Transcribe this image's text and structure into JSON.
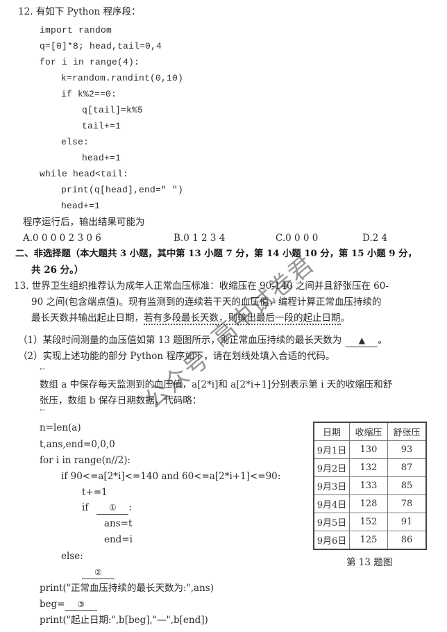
{
  "q12": {
    "title": "12. 有如下 Python 程序段：",
    "code": [
      "import random",
      "q=[0]*8; head,tail=0,4",
      "for i in range(4):",
      "k=random.randint(0,10)",
      "if k%2==0:",
      "q[tail]=k%5",
      "tail+=1",
      "else:",
      "head+=1",
      "while head<tail:",
      "print(q[head],end=\" \")",
      "head+=1"
    ],
    "prompt": "程序运行后，输出结果可能为",
    "options": [
      "A.0 0 0 0 2 3 0 6",
      "B.0 1 2 3 4",
      "C.0 0 0 0",
      "D.2 4"
    ]
  },
  "section2": {
    "heading_line1": "二、非选择题（本大题共 3 小题，其中第 13 小题 7 分，第 14 小题 10 分，第 15 小题 9 分，",
    "heading_line2": "共 26 分。）"
  },
  "q13": {
    "stem_line1": "13. 世界卫生组织推荐认为成年人正常血压标准：收缩压在 90-140 之间并且舒张压在 60-",
    "stem_line2": "90 之间(包含端点值)。现有监测到的连续若干天的血压值，编程计算正常血压持续的",
    "stem_line3_a": "最长天数并输出起止日期，",
    "stem_line3_b": "若有多段最长天数，则输出最后一段的起止日期",
    "stem_line3_c": "。",
    "part1_a": "（1）某段时间测量的血压值如第 13 题图所示，则正常血压持续的最长天数为",
    "part1_blank": "▲",
    "part1_b": "。",
    "part2": "（2）实现上述功能的部分 Python 程序如下，请在划线处填入合适的代码。",
    "docstring_quote": "'''",
    "comment_line1": "数组 a 中保存每天监测到的血压值，a[2*i]和 a[2*i+1]分别表示第 i 天的收缩压和舒",
    "comment_line2": "张压，数组 b 保存日期数据，代码略：",
    "code": {
      "l1": "n=len(a)",
      "l2": "t,ans,end=0,0,0",
      "l3": "for i in range(n//2):",
      "l4": "if 90<=a[2*i]<=140 and 60<=a[2*i+1]<=90:",
      "l5": "t+=1",
      "l6_kw": "if",
      "blank1": "①",
      "l6_end": ":",
      "l7": "ans=t",
      "l8": "end=i",
      "l9": "else:",
      "blank2": "②",
      "l10": "print(\"正常血压持续的最长天数为:\",ans)",
      "l11": "beg=",
      "blank3": "③",
      "l12": "print(\"起止日期:\",b[beg],\"—\",b[end])"
    },
    "table": {
      "headers": [
        "日期",
        "收缩压",
        "舒张压"
      ],
      "rows": [
        [
          "9月1日",
          "130",
          "93"
        ],
        [
          "9月2日",
          "132",
          "87"
        ],
        [
          "9月3日",
          "133",
          "85"
        ],
        [
          "9月4日",
          "128",
          "78"
        ],
        [
          "9月5日",
          "152",
          "91"
        ],
        [
          "9月6日",
          "125",
          "86"
        ]
      ],
      "caption": "第 13 题图"
    }
  },
  "watermark": {
    "part1": "公众号",
    "part2": "高中试卷君"
  }
}
